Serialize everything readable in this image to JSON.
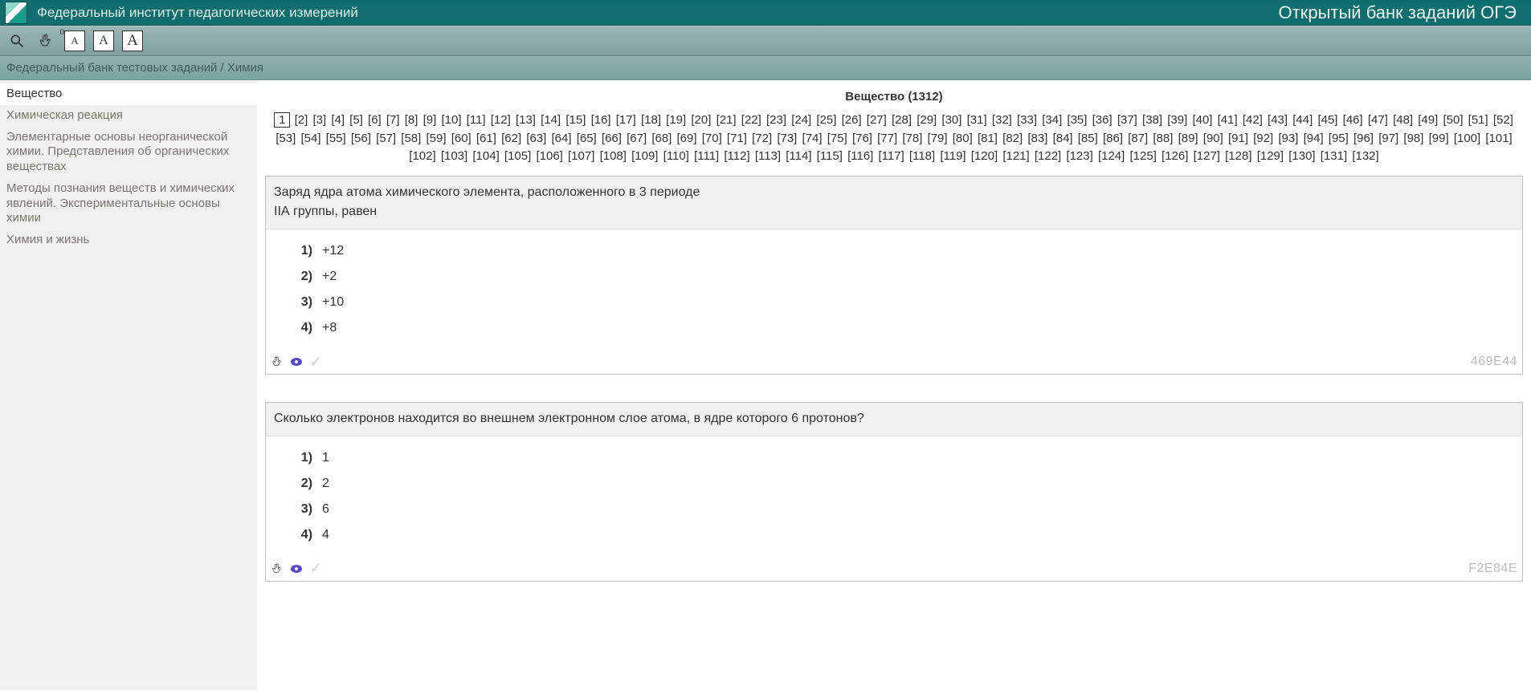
{
  "header": {
    "site_title": "Федеральный институт педагогических измерений",
    "right_title": "Открытый банк заданий ОГЭ"
  },
  "toolbar": {
    "basket_count": "0",
    "font_label_a": "A",
    "font_label_b": "A",
    "font_label_c": "A"
  },
  "breadcrumb": "Федеральный банк тестовых заданий / Химия",
  "sidebar": {
    "items": [
      {
        "label": "Вещество",
        "active": true
      },
      {
        "label": "Химическая реакция",
        "active": false
      },
      {
        "label": "Элементарные основы неорганической химии. Представления об органических веществах",
        "active": false
      },
      {
        "label": "Методы познания веществ и химических явлений. Экспериментальные основы химии",
        "active": false
      },
      {
        "label": "Химия и жизнь",
        "active": false
      }
    ]
  },
  "page": {
    "heading": "Вещество (1312)",
    "current_page": 1,
    "total_pages": 132
  },
  "questions": [
    {
      "text": "Заряд ядра атома химического элемента, расположенного в 3 периоде\nIIА группы, равен",
      "answers": [
        "+12",
        "+2",
        "+10",
        "+8"
      ],
      "code": "469E44"
    },
    {
      "text": "Сколько электронов находится во внешнем электронном слое атома, в ядре которого 6 протонов?",
      "answers": [
        "1",
        "2",
        "6",
        "4"
      ],
      "code": "F2E84E"
    }
  ]
}
